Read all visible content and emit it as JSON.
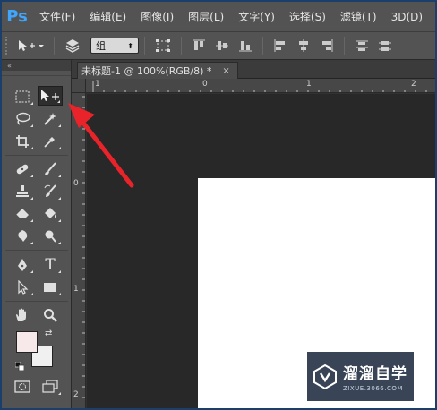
{
  "app": {
    "logo": "Ps"
  },
  "menubar": {
    "items": [
      "文件(F)",
      "编辑(E)",
      "图像(I)",
      "图层(L)",
      "文字(Y)",
      "选择(S)",
      "滤镜(T)",
      "3D(D)"
    ]
  },
  "options_bar": {
    "tool_icon": "move-tool-icon",
    "auto_select_icon": "layers-stack-icon",
    "auto_select_target": "组",
    "transform_controls_icon": "bounding-box-icon"
  },
  "toolbox": {
    "collapse_label": "«",
    "foreground_color": "#f7e8ea",
    "background_color": "#f0f0f0"
  },
  "document": {
    "tab_title": "未标题-1 @ 100%(RGB/8) *",
    "close_label": "×",
    "ruler_h_labels": [
      "1",
      "0",
      "1",
      "2"
    ],
    "ruler_v_labels": [
      "0",
      "1",
      "2"
    ],
    "canvas_color": "#ffffff"
  },
  "watermark": {
    "brand": "溜溜自学",
    "url": "ZIXUE.3066.COM"
  },
  "annotation": {
    "arrow_color": "#e8232a"
  }
}
